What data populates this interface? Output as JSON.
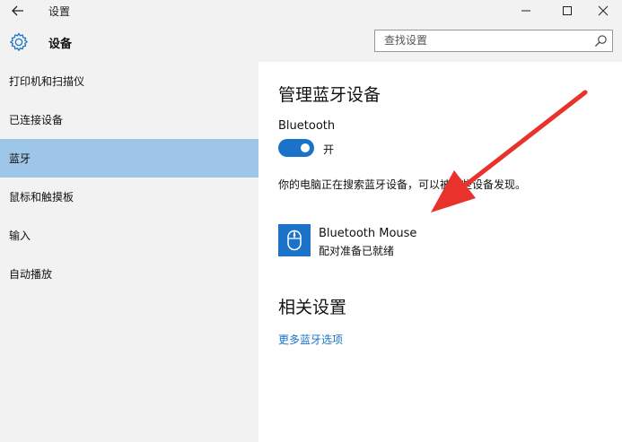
{
  "window": {
    "title": "设置"
  },
  "header": {
    "title": "设备",
    "search_placeholder": "查找设置"
  },
  "sidebar": {
    "items": [
      {
        "label": "打印机和扫描仪",
        "selected": false
      },
      {
        "label": "已连接设备",
        "selected": false
      },
      {
        "label": "蓝牙",
        "selected": true
      },
      {
        "label": "鼠标和触摸板",
        "selected": false
      },
      {
        "label": "输入",
        "selected": false
      },
      {
        "label": "自动播放",
        "selected": false
      }
    ]
  },
  "main": {
    "heading": "管理蓝牙设备",
    "bluetooth_label": "Bluetooth",
    "toggle_state": "开",
    "status_text": "你的电脑正在搜索蓝牙设备，可以被这些设备发现。",
    "device": {
      "name": "Bluetooth Mouse",
      "status": "配对准备已就绪",
      "icon": "mouse-icon"
    },
    "related_heading": "相关设置",
    "more_link": "更多蓝牙选项"
  },
  "colors": {
    "accent": "#1a73c9",
    "selected_nav": "#9ec6e8",
    "annotation_arrow": "#e8322c",
    "sidebar_bg": "#f2f2f2"
  }
}
